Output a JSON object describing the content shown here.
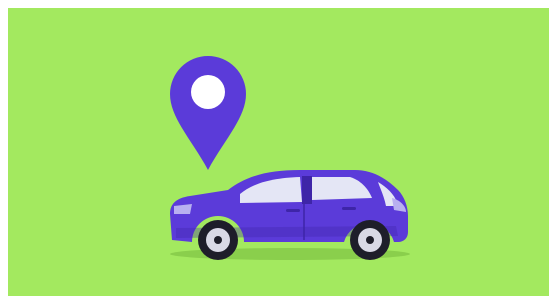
{
  "scene": {
    "subject": "car",
    "marker": "map-pin",
    "colors": {
      "background": "#A3E95F",
      "page": "#FFFFFF",
      "pin": "#5B3BD9",
      "pin_dot": "#FFFFFF",
      "car_body": "#5B3BD9",
      "car_shade": "#3E25A8",
      "car_window": "#E4E6F5",
      "tire": "#1E1E2A",
      "rim": "#D9D9E6",
      "headlight": "#B8B0F0",
      "ground_shadow": "#8ACF4C"
    }
  }
}
